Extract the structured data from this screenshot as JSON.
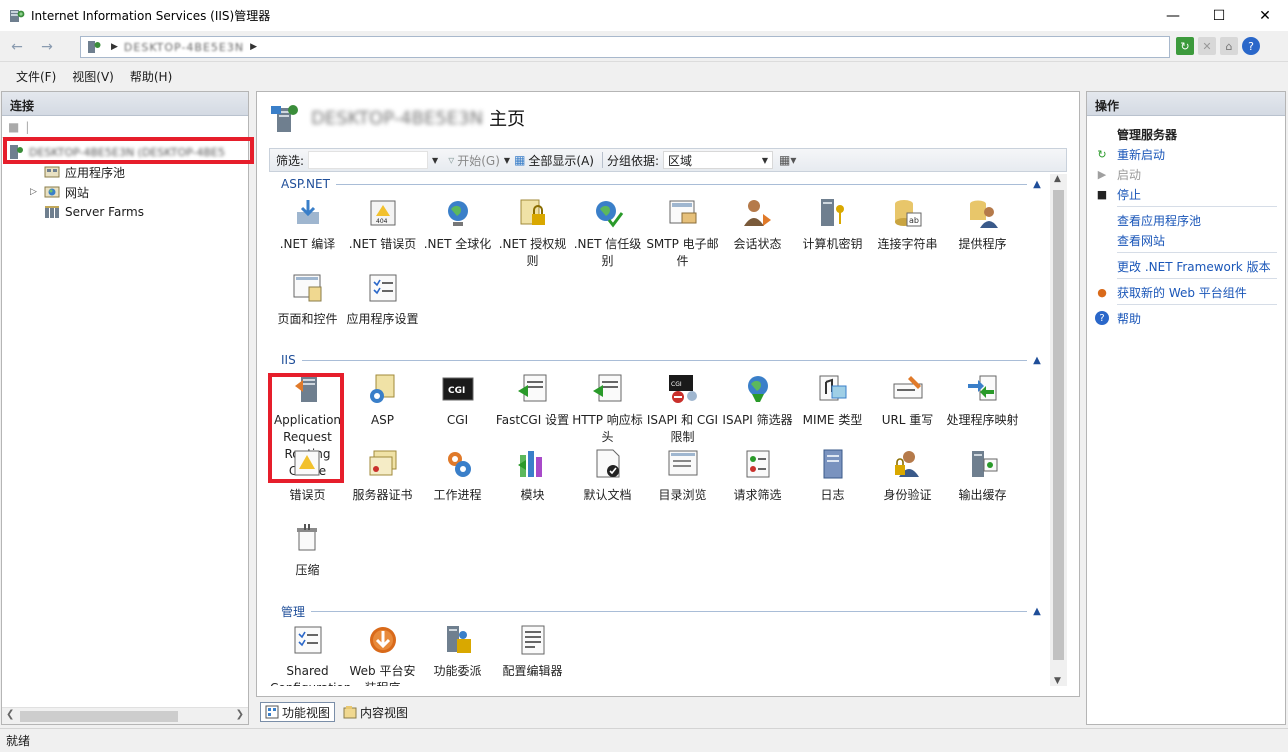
{
  "window": {
    "title": "Internet Information Services (IIS)管理器"
  },
  "address": {
    "crumb": "DESKTOP-4BE5E3N"
  },
  "menu": [
    "文件(F)",
    "视图(V)",
    "帮助(H)"
  ],
  "connections": {
    "header": "连接",
    "root": "DESKTOP-4BE5E3N (DESKTOP-4BE5",
    "children": [
      "应用程序池",
      "网站",
      "Server Farms"
    ]
  },
  "home": {
    "server_name_blurred": "DESKTOP-4BE5E3N",
    "title_suffix": "主页"
  },
  "filterbar": {
    "filter_label": "筛选:",
    "start_label": "开始(G)",
    "show_all_label": "全部显示(A)",
    "group_label": "分组依据:",
    "group_value": "区域"
  },
  "sections": [
    {
      "title": "ASP.NET",
      "items": [
        ".NET 编译",
        ".NET 错误页",
        ".NET 全球化",
        ".NET 授权规则",
        ".NET 信任级别",
        "SMTP 电子邮件",
        "会话状态",
        "计算机密钥",
        "连接字符串",
        "提供程序",
        "页面和控件",
        "应用程序设置"
      ]
    },
    {
      "title": "IIS",
      "items": [
        "Application Request Routing Cache",
        "ASP",
        "CGI",
        "FastCGI 设置",
        "HTTP 响应标头",
        "ISAPI 和 CGI 限制",
        "ISAPI 筛选器",
        "MIME 类型",
        "URL 重写",
        "处理程序映射",
        "错误页",
        "服务器证书",
        "工作进程",
        "模块",
        "默认文档",
        "目录浏览",
        "请求筛选",
        "日志",
        "身份验证",
        "输出缓存",
        "压缩"
      ]
    },
    {
      "title": "管理",
      "items": [
        "Shared Configuration",
        "Web 平台安装程序",
        "功能委派",
        "配置编辑器"
      ]
    }
  ],
  "view_tabs": [
    "功能视图",
    "内容视图"
  ],
  "actions": {
    "header": "操作",
    "group_title": "管理服务器",
    "items": [
      "重新启动",
      "启动",
      "停止",
      "查看应用程序池",
      "查看网站",
      "更改 .NET Framework 版本",
      "获取新的 Web 平台组件",
      "帮助"
    ]
  },
  "status": "就绪",
  "colors": {
    "accent": "#1a56b8",
    "highlight": "#e61e2b",
    "section": "#1f4e99"
  }
}
